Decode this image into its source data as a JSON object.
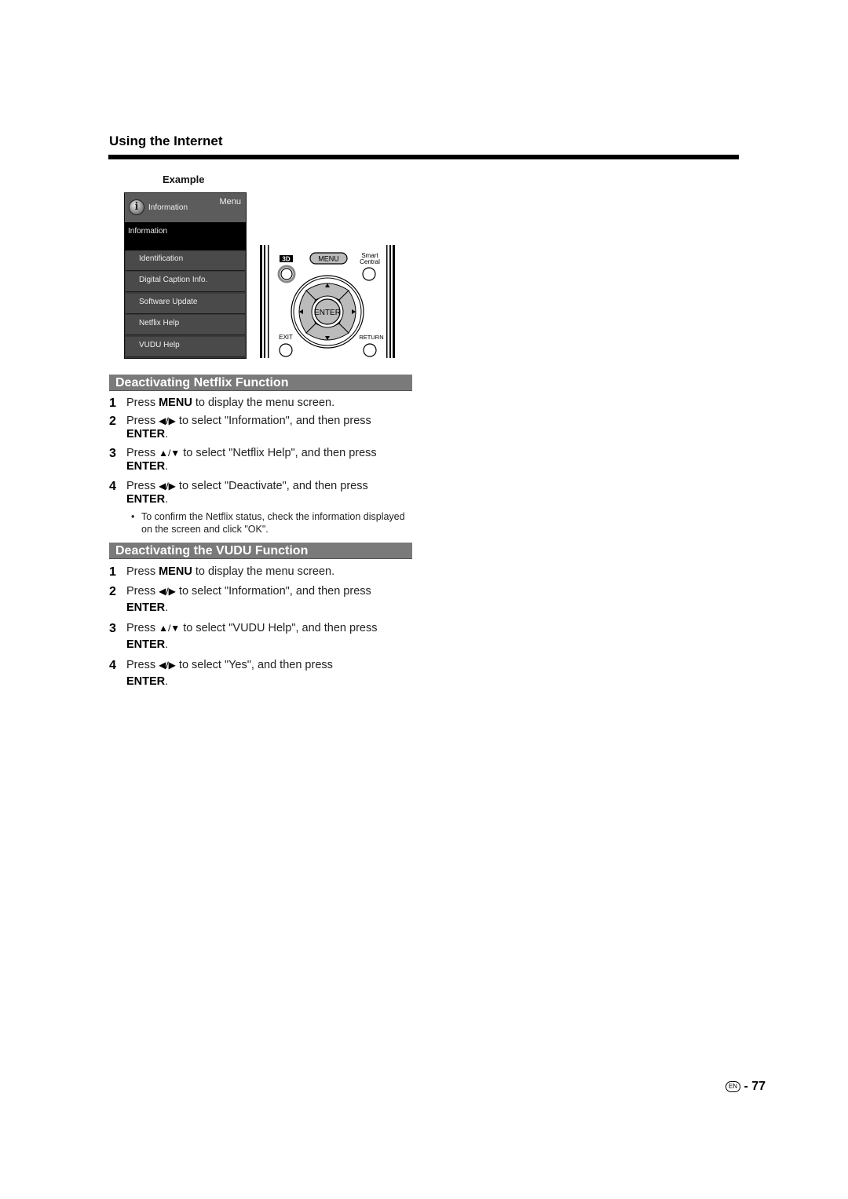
{
  "header": {
    "title": "Using the Internet"
  },
  "example": {
    "label": "Example",
    "tv_menu": {
      "header_title": "Information",
      "header_tab": "Menu",
      "submenu_title": "Information",
      "items": [
        "Identification",
        "Digital Caption Info.",
        "Software Update",
        "Netflix Help",
        "VUDU Help"
      ]
    },
    "remote": {
      "buttons": {
        "three_d": "3D",
        "menu": "MENU",
        "smart_central_line1": "Smart",
        "smart_central_line2": "Central",
        "enter": "ENTER",
        "exit": "EXIT",
        "return": "RETURN"
      }
    }
  },
  "netflix_section": {
    "title": "Deactivating Netflix Function",
    "steps": [
      {
        "num": "1",
        "pre": "Press ",
        "key": "MENU",
        "post": " to display the menu screen.",
        "arrows": "",
        "enter": ""
      },
      {
        "num": "2",
        "pre": "Press ",
        "arrows": "◀/▶",
        "post": " to select \"Information\", and then press",
        "enter": "ENTER"
      },
      {
        "num": "3",
        "pre": "Press ",
        "arrows": "▲/▼",
        "post": " to select \"Netflix Help\", and then press",
        "enter": "ENTER"
      },
      {
        "num": "4",
        "pre": "Press ",
        "arrows": "◀/▶",
        "post": " to select \"Deactivate\", and then press",
        "enter": "ENTER"
      }
    ],
    "note": "To confirm the Netflix status, check the information displayed on the screen and click \"OK\"."
  },
  "vudu_section": {
    "title": "Deactivating the VUDU Function",
    "steps": [
      {
        "num": "1",
        "pre": "Press ",
        "key": "MENU",
        "post": " to display the menu screen."
      },
      {
        "num": "2",
        "pre": "Press ",
        "arrows": "◀/▶",
        "post": " to select \"Information\", and then press",
        "enter": "ENTER"
      },
      {
        "num": "3",
        "pre": "Press ",
        "arrows": "▲/▼",
        "post": " to select \"VUDU Help\", and then press",
        "enter": "ENTER"
      },
      {
        "num": "4",
        "pre": "Press ",
        "arrows": "◀/▶",
        "post": " to select \"Yes\", and then press",
        "enter": "ENTER"
      }
    ]
  },
  "footer": {
    "lang_badge": "EN",
    "separator": "-",
    "page_number": "77"
  },
  "common": {
    "period": ".",
    "bullet": "•"
  }
}
